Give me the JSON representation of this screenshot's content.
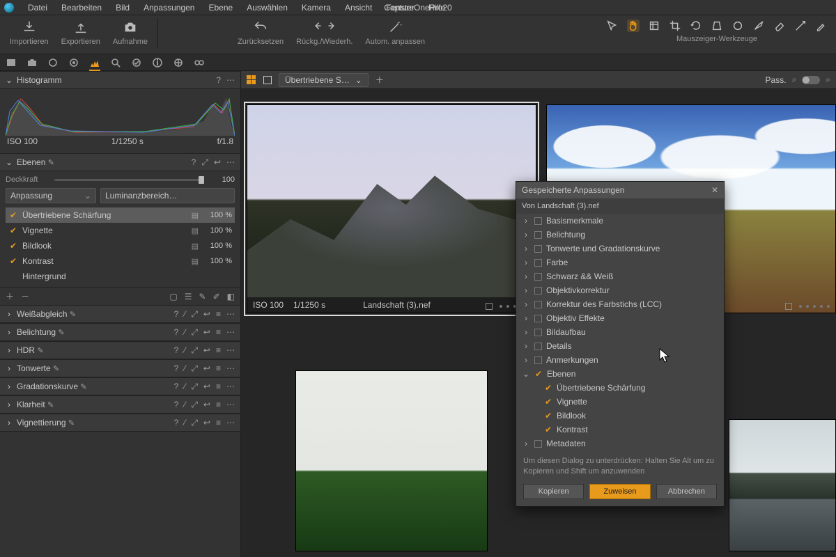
{
  "app_title": "CaptureOnePro20",
  "menu": [
    "Datei",
    "Bearbeiten",
    "Bild",
    "Anpassungen",
    "Ebene",
    "Auswählen",
    "Kamera",
    "Ansicht",
    "Fenster",
    "Hilfe"
  ],
  "toolbar": {
    "left": [
      {
        "id": "import",
        "label": "Importieren"
      },
      {
        "id": "export",
        "label": "Exportieren"
      },
      {
        "id": "capture",
        "label": "Aufnahme"
      }
    ],
    "mid": [
      {
        "id": "reset",
        "label": "Zurücksetzen"
      },
      {
        "id": "undoredo",
        "label": "Rückg./Wiederh."
      },
      {
        "id": "autoadjust",
        "label": "Autom. anpassen"
      }
    ],
    "cursor_label": "Mauszeiger-Werkzeuge"
  },
  "viewer_bar": {
    "preset": "Übertriebene S…",
    "pass_label": "Pass."
  },
  "histogram": {
    "title": "Histogramm",
    "iso": "ISO 100",
    "shutter": "1/1250 s",
    "aperture": "f/1.8"
  },
  "ebenen": {
    "title": "Ebenen",
    "opacity_label": "Deckkraft",
    "opacity_value": "100",
    "combo1": "Anpassung",
    "combo2": "Luminanzbereich…",
    "layers": [
      {
        "name": "Übertriebene Schärfung",
        "pct": "100 %",
        "sel": true
      },
      {
        "name": "Vignette",
        "pct": "100 %"
      },
      {
        "name": "Bildlook",
        "pct": "100 %"
      },
      {
        "name": "Kontrast",
        "pct": "100 %"
      },
      {
        "name": "Hintergrund",
        "pct": ""
      }
    ]
  },
  "panels": [
    "Weißabgleich",
    "Belichtung",
    "HDR",
    "Tonwerte",
    "Gradationskurve",
    "Klarheit",
    "Vignettierung"
  ],
  "thumb1": {
    "iso": "ISO 100",
    "shutter": "1/1250 s",
    "filename": "Landschaft (3).nef"
  },
  "dialog": {
    "title": "Gespeicherte Anpassungen",
    "subtitle": "Von Landschaft (3).nef",
    "sections": [
      {
        "name": "Basismerkmale"
      },
      {
        "name": "Belichtung"
      },
      {
        "name": "Tonwerte und Gradationskurve"
      },
      {
        "name": "Farbe"
      },
      {
        "name": "Schwarz && Weiß"
      },
      {
        "name": "Objektivkorrektur"
      },
      {
        "name": "Korrektur des Farbstichs (LCC)"
      },
      {
        "name": "Objektiv Effekte"
      },
      {
        "name": "Bildaufbau"
      },
      {
        "name": "Details"
      },
      {
        "name": "Anmerkungen"
      }
    ],
    "ebenen_section": "Ebenen",
    "ebenen_children": [
      "Übertriebene Schärfung",
      "Vignette",
      "Bildlook",
      "Kontrast"
    ],
    "metadata": "Metadaten",
    "hint": "Um diesen Dialog zu unterdrücken: Halten Sie Alt um zu Kopieren und Shift um anzuwenden",
    "btn_copy": "Kopieren",
    "btn_apply": "Zuweisen",
    "btn_cancel": "Abbrechen"
  }
}
